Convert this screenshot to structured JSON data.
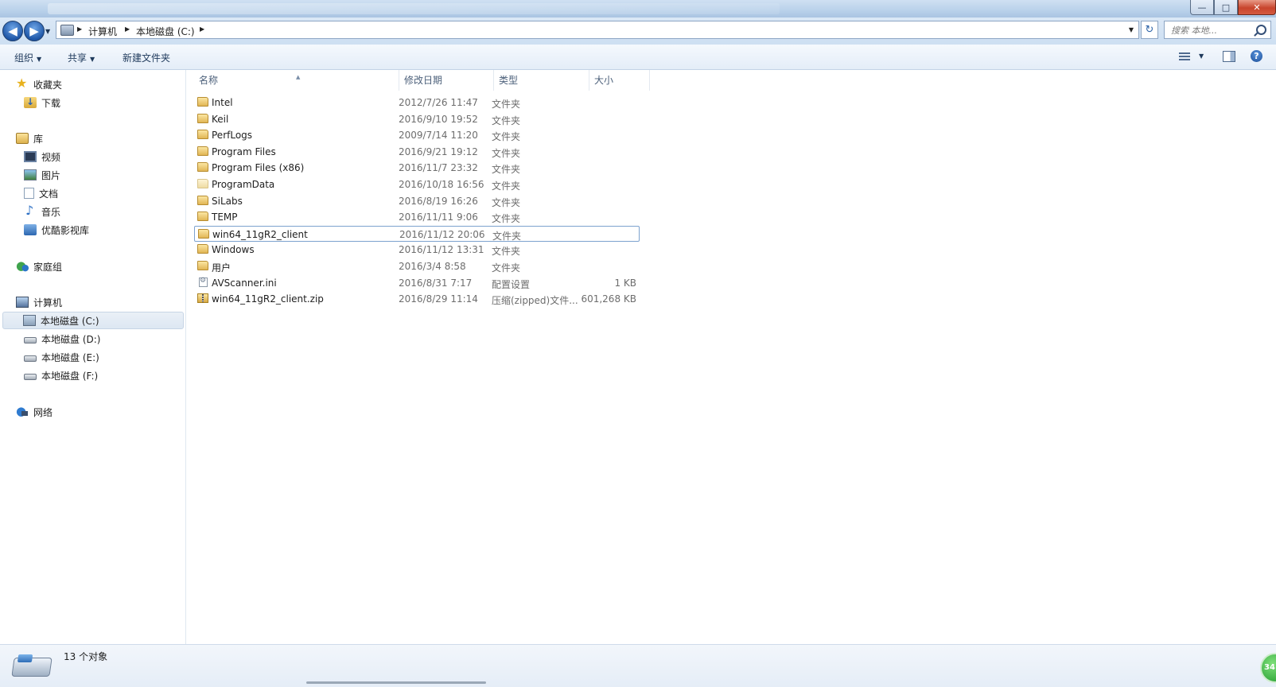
{
  "window": {
    "controls": {
      "minimize": "—",
      "maximize": "□",
      "close": "✕"
    }
  },
  "address_bar": {
    "crumbs": [
      "计算机",
      "本地磁盘 (C:)"
    ],
    "search_placeholder": "搜索 本地..."
  },
  "toolbar": {
    "organize": "组织",
    "share": "共享",
    "new_folder": "新建文件夹"
  },
  "sidebar": {
    "favorites": {
      "label": "收藏夹",
      "items": [
        {
          "label": "下载"
        }
      ]
    },
    "libraries": {
      "label": "库",
      "items": [
        {
          "label": "视频"
        },
        {
          "label": "图片"
        },
        {
          "label": "文档"
        },
        {
          "label": "音乐"
        },
        {
          "label": "优酷影视库"
        }
      ]
    },
    "homegroup": {
      "label": "家庭组"
    },
    "computer": {
      "label": "计算机",
      "items": [
        {
          "label": "本地磁盘 (C:)",
          "selected": true
        },
        {
          "label": "本地磁盘 (D:)"
        },
        {
          "label": "本地磁盘 (E:)"
        },
        {
          "label": "本地磁盘 (F:)"
        }
      ]
    },
    "network": {
      "label": "网络"
    }
  },
  "file_list": {
    "columns": {
      "name": "名称",
      "modified": "修改日期",
      "type": "类型",
      "size": "大小"
    },
    "rows": [
      {
        "name": "Intel",
        "modified": "2012/7/26 11:47",
        "type": "文件夹",
        "size": "",
        "icon": "folder-icon"
      },
      {
        "name": "Keil",
        "modified": "2016/9/10 19:52",
        "type": "文件夹",
        "size": "",
        "icon": "folder-icon"
      },
      {
        "name": "PerfLogs",
        "modified": "2009/7/14 11:20",
        "type": "文件夹",
        "size": "",
        "icon": "folder-icon"
      },
      {
        "name": "Program Files",
        "modified": "2016/9/21 19:12",
        "type": "文件夹",
        "size": "",
        "icon": "folder-icon"
      },
      {
        "name": "Program Files (x86)",
        "modified": "2016/11/7 23:32",
        "type": "文件夹",
        "size": "",
        "icon": "folder-icon"
      },
      {
        "name": "ProgramData",
        "modified": "2016/10/18 16:56",
        "type": "文件夹",
        "size": "",
        "icon": "folder-pale-icon"
      },
      {
        "name": "SiLabs",
        "modified": "2016/8/19 16:26",
        "type": "文件夹",
        "size": "",
        "icon": "folder-icon"
      },
      {
        "name": "TEMP",
        "modified": "2016/11/11 9:06",
        "type": "文件夹",
        "size": "",
        "icon": "folder-icon"
      },
      {
        "name": "win64_11gR2_client",
        "modified": "2016/11/12 20:06",
        "type": "文件夹",
        "size": "",
        "icon": "folder-icon",
        "focused": true
      },
      {
        "name": "Windows",
        "modified": "2016/11/12 13:31",
        "type": "文件夹",
        "size": "",
        "icon": "folder-icon"
      },
      {
        "name": "用户",
        "modified": "2016/3/4 8:58",
        "type": "文件夹",
        "size": "",
        "icon": "folder-icon"
      },
      {
        "name": "AVScanner.ini",
        "modified": "2016/8/31 7:17",
        "type": "配置设置",
        "size": "1 KB",
        "icon": "ini-file-icon"
      },
      {
        "name": "win64_11gR2_client.zip",
        "modified": "2016/8/29 11:14",
        "type": "压缩(zipped)文件...",
        "size": "601,268 KB",
        "icon": "zip-file-icon"
      }
    ]
  },
  "details_pane": {
    "object_count": "13 个对象",
    "badge_text": "34"
  }
}
